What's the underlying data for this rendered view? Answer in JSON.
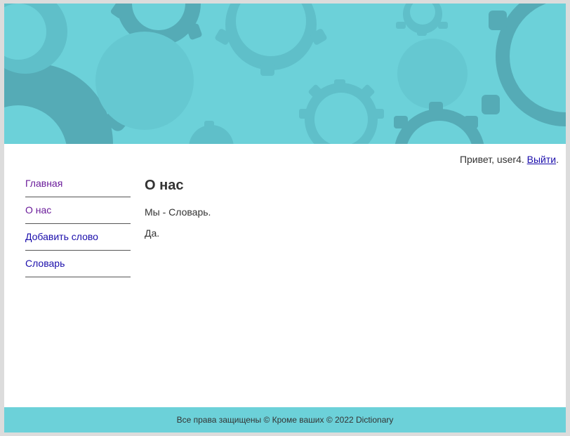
{
  "header": {
    "banner_color": "#6cd1d9",
    "gear_dark_color": "#55abb6",
    "gear_mid_color": "#5fbfc9"
  },
  "user_bar": {
    "greeting": "Привет, user4.",
    "logout_label": "Выйти",
    "trailing": "."
  },
  "sidebar": {
    "items": [
      {
        "label": "Главная",
        "visited": true
      },
      {
        "label": "О нас",
        "visited": true
      },
      {
        "label": "Добавить слово",
        "visited": false
      },
      {
        "label": "Словарь",
        "visited": false
      }
    ]
  },
  "main": {
    "title": "О нас",
    "paragraphs": [
      "Мы - Словарь.",
      "Да."
    ]
  },
  "footer": {
    "text": "Все права защищены © Кроме ваших © 2022 Dictionary"
  }
}
